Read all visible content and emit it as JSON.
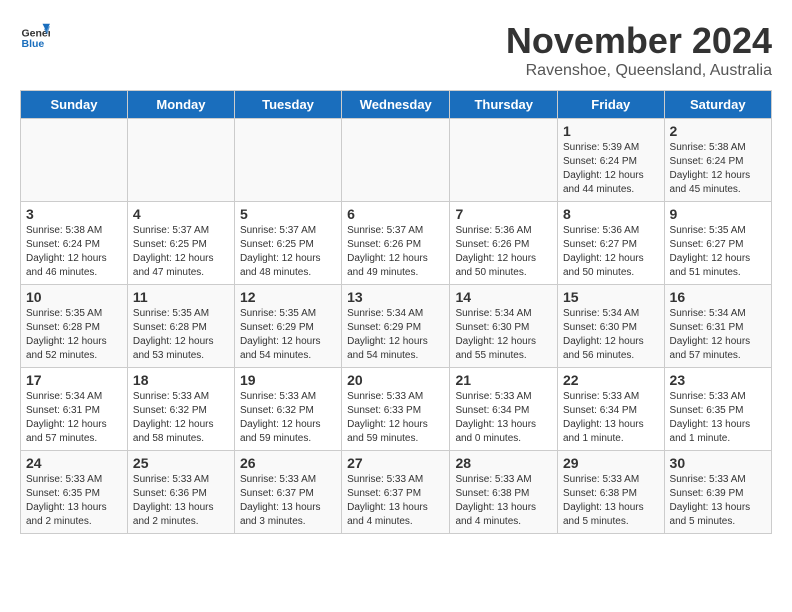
{
  "header": {
    "logo_general": "General",
    "logo_blue": "Blue",
    "main_title": "November 2024",
    "subtitle": "Ravenshoe, Queensland, Australia"
  },
  "weekdays": [
    "Sunday",
    "Monday",
    "Tuesday",
    "Wednesday",
    "Thursday",
    "Friday",
    "Saturday"
  ],
  "weeks": [
    [
      {
        "day": "",
        "info": ""
      },
      {
        "day": "",
        "info": ""
      },
      {
        "day": "",
        "info": ""
      },
      {
        "day": "",
        "info": ""
      },
      {
        "day": "",
        "info": ""
      },
      {
        "day": "1",
        "info": "Sunrise: 5:39 AM\nSunset: 6:24 PM\nDaylight: 12 hours and 44 minutes."
      },
      {
        "day": "2",
        "info": "Sunrise: 5:38 AM\nSunset: 6:24 PM\nDaylight: 12 hours and 45 minutes."
      }
    ],
    [
      {
        "day": "3",
        "info": "Sunrise: 5:38 AM\nSunset: 6:24 PM\nDaylight: 12 hours and 46 minutes."
      },
      {
        "day": "4",
        "info": "Sunrise: 5:37 AM\nSunset: 6:25 PM\nDaylight: 12 hours and 47 minutes."
      },
      {
        "day": "5",
        "info": "Sunrise: 5:37 AM\nSunset: 6:25 PM\nDaylight: 12 hours and 48 minutes."
      },
      {
        "day": "6",
        "info": "Sunrise: 5:37 AM\nSunset: 6:26 PM\nDaylight: 12 hours and 49 minutes."
      },
      {
        "day": "7",
        "info": "Sunrise: 5:36 AM\nSunset: 6:26 PM\nDaylight: 12 hours and 50 minutes."
      },
      {
        "day": "8",
        "info": "Sunrise: 5:36 AM\nSunset: 6:27 PM\nDaylight: 12 hours and 50 minutes."
      },
      {
        "day": "9",
        "info": "Sunrise: 5:35 AM\nSunset: 6:27 PM\nDaylight: 12 hours and 51 minutes."
      }
    ],
    [
      {
        "day": "10",
        "info": "Sunrise: 5:35 AM\nSunset: 6:28 PM\nDaylight: 12 hours and 52 minutes."
      },
      {
        "day": "11",
        "info": "Sunrise: 5:35 AM\nSunset: 6:28 PM\nDaylight: 12 hours and 53 minutes."
      },
      {
        "day": "12",
        "info": "Sunrise: 5:35 AM\nSunset: 6:29 PM\nDaylight: 12 hours and 54 minutes."
      },
      {
        "day": "13",
        "info": "Sunrise: 5:34 AM\nSunset: 6:29 PM\nDaylight: 12 hours and 54 minutes."
      },
      {
        "day": "14",
        "info": "Sunrise: 5:34 AM\nSunset: 6:30 PM\nDaylight: 12 hours and 55 minutes."
      },
      {
        "day": "15",
        "info": "Sunrise: 5:34 AM\nSunset: 6:30 PM\nDaylight: 12 hours and 56 minutes."
      },
      {
        "day": "16",
        "info": "Sunrise: 5:34 AM\nSunset: 6:31 PM\nDaylight: 12 hours and 57 minutes."
      }
    ],
    [
      {
        "day": "17",
        "info": "Sunrise: 5:34 AM\nSunset: 6:31 PM\nDaylight: 12 hours and 57 minutes."
      },
      {
        "day": "18",
        "info": "Sunrise: 5:33 AM\nSunset: 6:32 PM\nDaylight: 12 hours and 58 minutes."
      },
      {
        "day": "19",
        "info": "Sunrise: 5:33 AM\nSunset: 6:32 PM\nDaylight: 12 hours and 59 minutes."
      },
      {
        "day": "20",
        "info": "Sunrise: 5:33 AM\nSunset: 6:33 PM\nDaylight: 12 hours and 59 minutes."
      },
      {
        "day": "21",
        "info": "Sunrise: 5:33 AM\nSunset: 6:34 PM\nDaylight: 13 hours and 0 minutes."
      },
      {
        "day": "22",
        "info": "Sunrise: 5:33 AM\nSunset: 6:34 PM\nDaylight: 13 hours and 1 minute."
      },
      {
        "day": "23",
        "info": "Sunrise: 5:33 AM\nSunset: 6:35 PM\nDaylight: 13 hours and 1 minute."
      }
    ],
    [
      {
        "day": "24",
        "info": "Sunrise: 5:33 AM\nSunset: 6:35 PM\nDaylight: 13 hours and 2 minutes."
      },
      {
        "day": "25",
        "info": "Sunrise: 5:33 AM\nSunset: 6:36 PM\nDaylight: 13 hours and 2 minutes."
      },
      {
        "day": "26",
        "info": "Sunrise: 5:33 AM\nSunset: 6:37 PM\nDaylight: 13 hours and 3 minutes."
      },
      {
        "day": "27",
        "info": "Sunrise: 5:33 AM\nSunset: 6:37 PM\nDaylight: 13 hours and 4 minutes."
      },
      {
        "day": "28",
        "info": "Sunrise: 5:33 AM\nSunset: 6:38 PM\nDaylight: 13 hours and 4 minutes."
      },
      {
        "day": "29",
        "info": "Sunrise: 5:33 AM\nSunset: 6:38 PM\nDaylight: 13 hours and 5 minutes."
      },
      {
        "day": "30",
        "info": "Sunrise: 5:33 AM\nSunset: 6:39 PM\nDaylight: 13 hours and 5 minutes."
      }
    ]
  ]
}
